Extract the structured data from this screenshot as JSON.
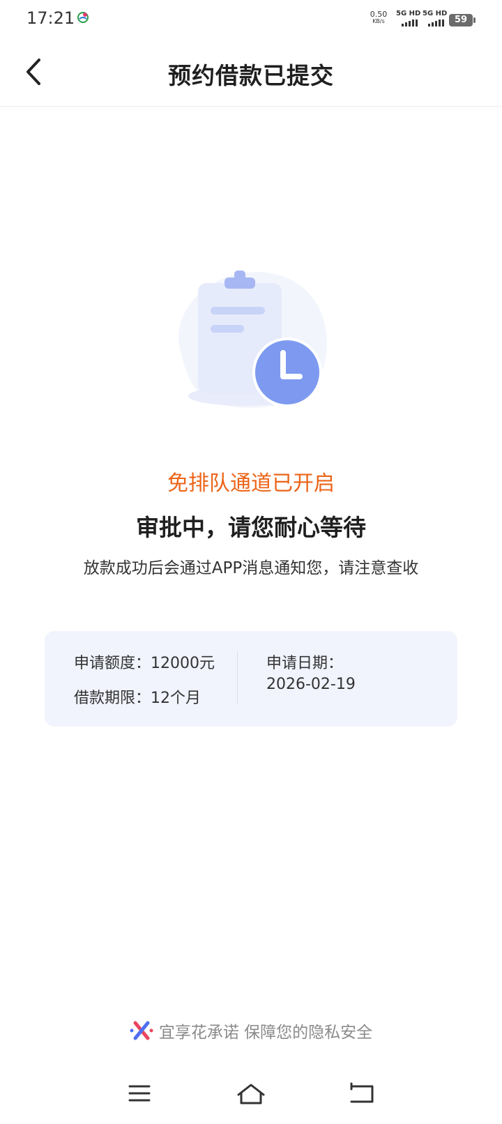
{
  "status_bar": {
    "time": "17:21",
    "net_speed_value": "0.50",
    "net_speed_unit": "KB/s",
    "sim1_label": "5G HD",
    "sim2_label": "5G HD",
    "battery": "59"
  },
  "header": {
    "title": "预约借款已提交"
  },
  "result": {
    "highlight": "免排队通道已开启",
    "status": "审批中，请您耐心等待",
    "notice": "放款成功后会通过APP消息通知您，请注意查收"
  },
  "info": {
    "amount_label": "申请额度：",
    "amount_value": "12000元",
    "term_label": "借款期限：",
    "term_value": "12个月",
    "date_label": "申请日期：",
    "date_value": "2026-02-19"
  },
  "footer": {
    "text": "宜享花承诺 保障您的隐私安全"
  },
  "colors": {
    "accent_orange": "#ec6418",
    "card_bg": "#f1f3fd",
    "illustration_blue": "#7d9af0"
  },
  "icons": {
    "back": "chevron-left-icon",
    "clipboard": "clipboard-clock-illustration",
    "menu": "menu-icon",
    "home": "home-icon",
    "return": "return-icon"
  }
}
